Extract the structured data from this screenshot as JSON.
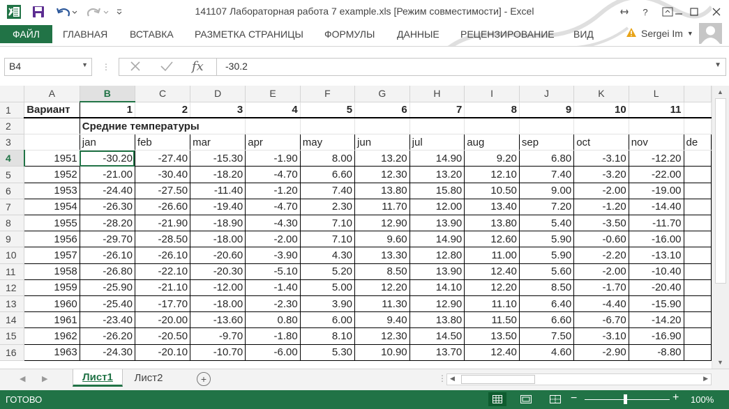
{
  "window": {
    "title": "141107 Лабораторная работа 7 example.xls  [Режим совместимости] - Excel"
  },
  "ribbon": {
    "file_tab": "ФАЙЛ",
    "tabs": [
      "ГЛАВНАЯ",
      "ВСТАВКА",
      "РАЗМЕТКА СТРАНИЦЫ",
      "ФОРМУЛЫ",
      "ДАННЫЕ",
      "РЕЦЕНЗИРОВАНИЕ",
      "ВИД"
    ],
    "user_name": "Sergei Im"
  },
  "formula_bar": {
    "name_box": "B4",
    "formula": "-30.2"
  },
  "grid": {
    "column_headers": [
      "A",
      "B",
      "C",
      "D",
      "E",
      "F",
      "G",
      "H",
      "I",
      "J",
      "K",
      "L"
    ],
    "selected_column": "B",
    "row_numbers": [
      "1",
      "2",
      "3",
      "4",
      "5",
      "6",
      "7",
      "8",
      "9",
      "10",
      "11",
      "12",
      "13",
      "14",
      "15",
      "16"
    ],
    "selected_row": "4",
    "row1": {
      "label": "Вариант",
      "values": [
        "1",
        "2",
        "3",
        "4",
        "5",
        "6",
        "7",
        "8",
        "9",
        "10",
        "11"
      ]
    },
    "row2_title": "Средние температуры",
    "months": [
      "jan",
      "feb",
      "mar",
      "apr",
      "may",
      "jun",
      "jul",
      "aug",
      "sep",
      "oct",
      "nov",
      "de"
    ],
    "data_rows": [
      [
        "1951",
        "-30.20",
        "-27.40",
        "-15.30",
        "-1.90",
        "8.00",
        "13.20",
        "14.90",
        "9.20",
        "6.80",
        "-3.10",
        "-12.20"
      ],
      [
        "1952",
        "-21.00",
        "-30.40",
        "-18.20",
        "-4.70",
        "6.60",
        "12.30",
        "13.20",
        "12.10",
        "7.40",
        "-3.20",
        "-22.00"
      ],
      [
        "1953",
        "-24.40",
        "-27.50",
        "-11.40",
        "-1.20",
        "7.40",
        "13.80",
        "15.80",
        "10.50",
        "9.00",
        "-2.00",
        "-19.00"
      ],
      [
        "1954",
        "-26.30",
        "-26.60",
        "-19.40",
        "-4.70",
        "2.30",
        "11.70",
        "12.00",
        "13.40",
        "7.20",
        "-1.20",
        "-14.40"
      ],
      [
        "1955",
        "-28.20",
        "-21.90",
        "-18.90",
        "-4.30",
        "7.10",
        "12.90",
        "13.90",
        "13.80",
        "5.40",
        "-3.50",
        "-11.70"
      ],
      [
        "1956",
        "-29.70",
        "-28.50",
        "-18.00",
        "-2.00",
        "7.10",
        "9.60",
        "14.90",
        "12.60",
        "5.90",
        "-0.60",
        "-16.00"
      ],
      [
        "1957",
        "-26.10",
        "-26.10",
        "-20.60",
        "-3.90",
        "4.30",
        "13.30",
        "12.80",
        "11.00",
        "5.90",
        "-2.20",
        "-13.10"
      ],
      [
        "1958",
        "-26.80",
        "-22.10",
        "-20.30",
        "-5.10",
        "5.20",
        "8.50",
        "13.90",
        "12.40",
        "5.60",
        "-2.00",
        "-10.40"
      ],
      [
        "1959",
        "-25.90",
        "-21.10",
        "-12.00",
        "-1.40",
        "5.00",
        "12.20",
        "14.10",
        "12.20",
        "8.50",
        "-1.70",
        "-20.40"
      ],
      [
        "1960",
        "-25.40",
        "-17.70",
        "-18.00",
        "-2.30",
        "3.90",
        "11.30",
        "12.90",
        "11.10",
        "6.40",
        "-4.40",
        "-15.90"
      ],
      [
        "1961",
        "-23.40",
        "-20.00",
        "-13.60",
        "0.80",
        "6.00",
        "9.40",
        "13.80",
        "11.50",
        "6.60",
        "-6.70",
        "-14.20"
      ],
      [
        "1962",
        "-26.20",
        "-20.50",
        "-9.70",
        "-1.80",
        "8.10",
        "12.30",
        "14.50",
        "13.50",
        "7.50",
        "-3.10",
        "-16.90"
      ],
      [
        "1963",
        "-24.30",
        "-20.10",
        "-10.70",
        "-6.00",
        "5.30",
        "10.90",
        "13.70",
        "12.40",
        "4.60",
        "-2.90",
        "-8.80"
      ]
    ]
  },
  "sheets": {
    "tabs": [
      "Лист1",
      "Лист2"
    ],
    "active": "Лист1"
  },
  "status_bar": {
    "ready_text": "ГОТОВО",
    "zoom": "100%"
  },
  "colors": {
    "accent": "#217346",
    "header_bg": "#f3f3f3"
  }
}
